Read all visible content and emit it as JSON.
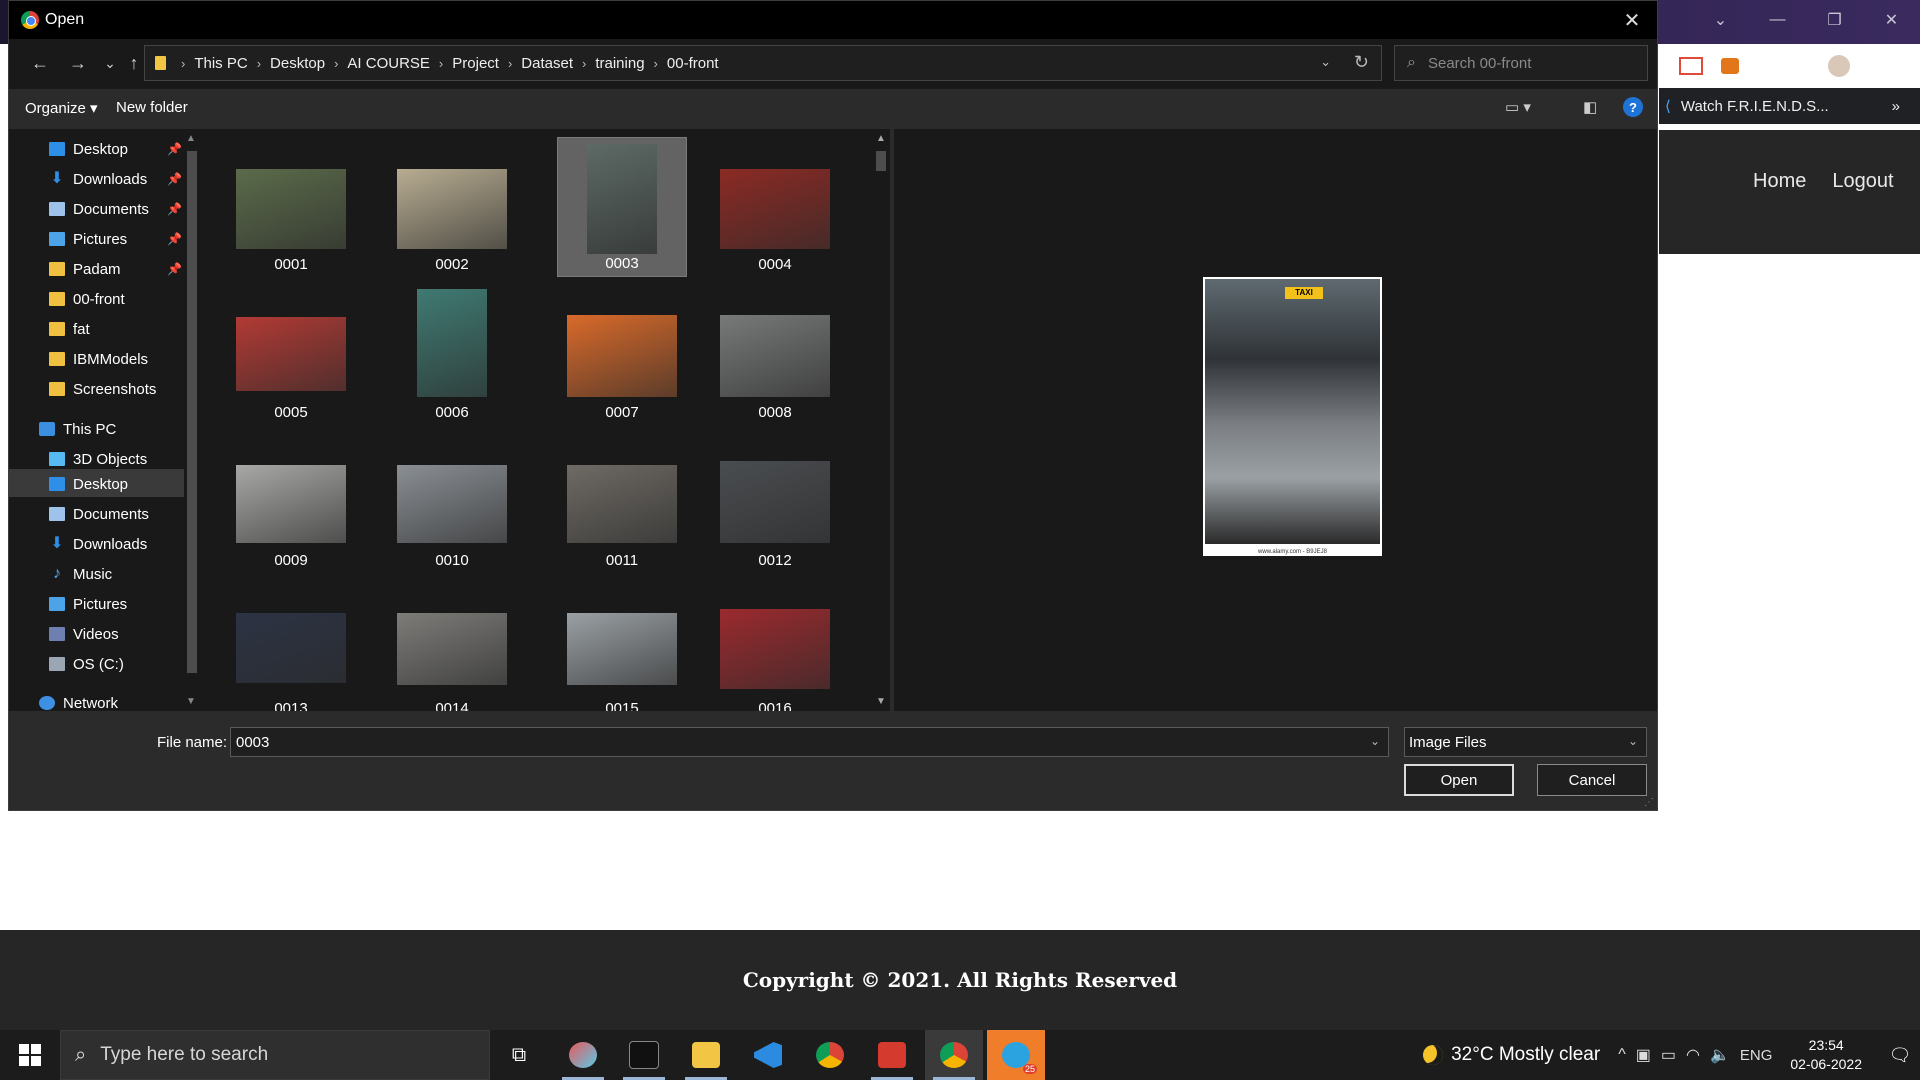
{
  "dialog": {
    "title": "Open",
    "close_glyph": "✕",
    "nav": {
      "back": "←",
      "forward": "→",
      "recent": "⌄",
      "up": "↑"
    },
    "breadcrumb": [
      "This PC",
      "Desktop",
      "AI COURSE",
      "Project",
      "Dataset",
      "training",
      "00-front"
    ],
    "search_placeholder": "Search 00-front",
    "toolbar": {
      "organize": "Organize ▾",
      "new_folder": "New folder",
      "help": "?"
    },
    "nav_pane": {
      "quick_access": [
        {
          "label": "Desktop",
          "icon": "desktop-icon",
          "pinned": true
        },
        {
          "label": "Downloads",
          "icon": "download-icon",
          "pinned": true
        },
        {
          "label": "Documents",
          "icon": "documents-icon",
          "pinned": true
        },
        {
          "label": "Pictures",
          "icon": "pictures-icon",
          "pinned": true
        },
        {
          "label": "Padam",
          "icon": "folder-icon",
          "pinned": true
        },
        {
          "label": "00-front",
          "icon": "folder-icon",
          "pinned": false
        },
        {
          "label": "fat",
          "icon": "folder-icon",
          "pinned": false
        },
        {
          "label": "IBMModels",
          "icon": "folder-icon",
          "pinned": false
        },
        {
          "label": "Screenshots",
          "icon": "folder-icon",
          "pinned": false
        }
      ],
      "this_pc": "This PC",
      "this_pc_items": [
        {
          "label": "3D Objects",
          "icon": "3d-objects-icon"
        },
        {
          "label": "Desktop",
          "icon": "desktop-icon",
          "selected": true
        },
        {
          "label": "Documents",
          "icon": "documents-icon"
        },
        {
          "label": "Downloads",
          "icon": "download-icon"
        },
        {
          "label": "Music",
          "icon": "music-icon"
        },
        {
          "label": "Pictures",
          "icon": "pictures-icon"
        },
        {
          "label": "Videos",
          "icon": "videos-icon"
        },
        {
          "label": "OS (C:)",
          "icon": "drive-icon"
        }
      ],
      "network": "Network"
    },
    "files": [
      {
        "name": "0001",
        "color": "#5b6b4a"
      },
      {
        "name": "0002",
        "color": "#b8ad92"
      },
      {
        "name": "0003",
        "color": "#5d6a66",
        "selected": true
      },
      {
        "name": "0004",
        "color": "#8c2a24"
      },
      {
        "name": "0005",
        "color": "#b23a34"
      },
      {
        "name": "0006",
        "color": "#3f7a72"
      },
      {
        "name": "0007",
        "color": "#d96a2a"
      },
      {
        "name": "0008",
        "color": "#777a78"
      },
      {
        "name": "0009",
        "color": "#a8a8a6"
      },
      {
        "name": "0010",
        "color": "#8a8f94"
      },
      {
        "name": "0011",
        "color": "#6e6a64"
      },
      {
        "name": "0012",
        "color": "#4a4d50"
      },
      {
        "name": "0013",
        "color": "#2c3344"
      },
      {
        "name": "0014",
        "color": "#7d7c79"
      },
      {
        "name": "0015",
        "color": "#9aa0a4"
      },
      {
        "name": "0016",
        "color": "#9b2a2e"
      }
    ],
    "preview": {
      "badge": "TAXI",
      "watermark_caption": "www.alamy.com - B9JEJ8"
    },
    "file_name_label": "File name:",
    "file_name_value": "0003",
    "file_type": "Image Files",
    "open_button": "Open",
    "cancel_button": "Cancel"
  },
  "browser": {
    "bookmark": "Watch F.R.I.E.N.D.S...",
    "more": "»",
    "nav": [
      "Home",
      "Logout"
    ],
    "footer": "Copyright © 2021. All Rights Reserved"
  },
  "taskbar": {
    "search_placeholder": "Type here to search",
    "apps": [
      "task-view",
      "paint-3d",
      "terminal",
      "file-explorer",
      "vscode",
      "chrome",
      "vivaldi",
      "chrome-profile",
      "telegram"
    ],
    "telegram_badge": "25",
    "weather": "32°C  Mostly clear",
    "language": "ENG",
    "time": "23:54",
    "date": "02-06-2022"
  },
  "colors": {
    "accent": "#1e73d6",
    "selection": "#636363",
    "dialog_bg": "#2b2b2b",
    "pane_bg": "#191919"
  }
}
